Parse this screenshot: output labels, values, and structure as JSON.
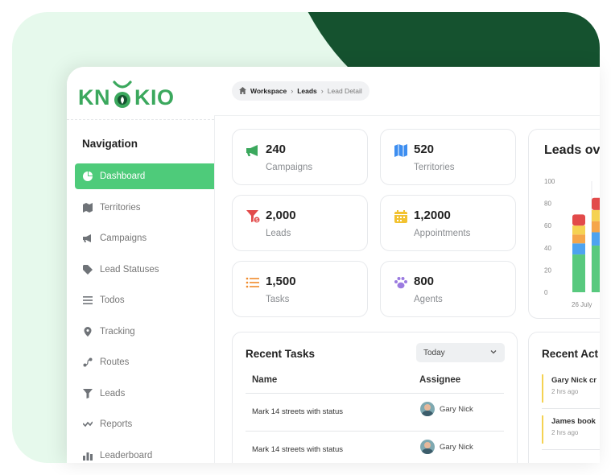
{
  "brand": {
    "logo_text_left": "KN",
    "logo_text_right": "KIO",
    "color": "#3ba85d",
    "dark_accent": "#15522f"
  },
  "sidebar": {
    "title": "Navigation",
    "items": [
      {
        "label": "Dashboard",
        "icon": "pie-chart-icon",
        "active": true
      },
      {
        "label": "Territories",
        "icon": "map-icon"
      },
      {
        "label": "Campaigns",
        "icon": "megaphone-icon"
      },
      {
        "label": "Lead Statuses",
        "icon": "tag-icon"
      },
      {
        "label": "Todos",
        "icon": "list-icon"
      },
      {
        "label": "Tracking",
        "icon": "location-pin-icon"
      },
      {
        "label": "Routes",
        "icon": "route-icon"
      },
      {
        "label": "Leads",
        "icon": "funnel-icon"
      },
      {
        "label": "Reports",
        "icon": "trend-icon"
      },
      {
        "label": "Leaderboard",
        "icon": "bar-chart-icon"
      }
    ]
  },
  "breadcrumb": {
    "items": [
      "Workspace",
      "Leads",
      "Lead Detail"
    ]
  },
  "stats": [
    {
      "value": "240",
      "label": "Campaigns",
      "icon": "megaphone-icon",
      "color": "#3ba85d"
    },
    {
      "value": "520",
      "label": "Territories",
      "icon": "map-icon",
      "color": "#3d8ef0"
    },
    {
      "value": "2,000",
      "label": "Leads",
      "icon": "funnel-icon",
      "color": "#e24a4a"
    },
    {
      "value": "1,2000",
      "label": "Appointments",
      "icon": "calendar-icon",
      "color": "#f2c230"
    },
    {
      "value": "1,500",
      "label": "Tasks",
      "icon": "list-icon",
      "color": "#f08a2a"
    },
    {
      "value": "800",
      "label": "Agents",
      "icon": "paw-icon",
      "color": "#9b7be0"
    }
  ],
  "leads_chart": {
    "title": "Leads ov",
    "y_ticks": [
      "100",
      "80",
      "60",
      "40",
      "20",
      "0"
    ],
    "x_label": "26 July",
    "ymax": 100,
    "bars": [
      {
        "segments": [
          34,
          10,
          8,
          8,
          10
        ]
      },
      {
        "segments": [
          42,
          12,
          10,
          10,
          11
        ]
      }
    ],
    "segment_colors": [
      "#58c97e",
      "#4ea3f0",
      "#f5a64a",
      "#f5d252",
      "#e24a4a"
    ]
  },
  "recent_tasks": {
    "title": "Recent Tasks",
    "filter": "Today",
    "columns": [
      "Name",
      "Assignee"
    ],
    "rows": [
      {
        "name": "Mark 14 streets with status",
        "assignee": "Gary Nick"
      },
      {
        "name": "Mark 14 streets with status",
        "assignee": "Gary Nick"
      }
    ]
  },
  "recent_activity": {
    "title": "Recent Act",
    "items": [
      {
        "text": "Gary Nick cr",
        "time": "2 hrs ago"
      },
      {
        "text": "James book",
        "time": "2 hrs ago"
      }
    ]
  }
}
